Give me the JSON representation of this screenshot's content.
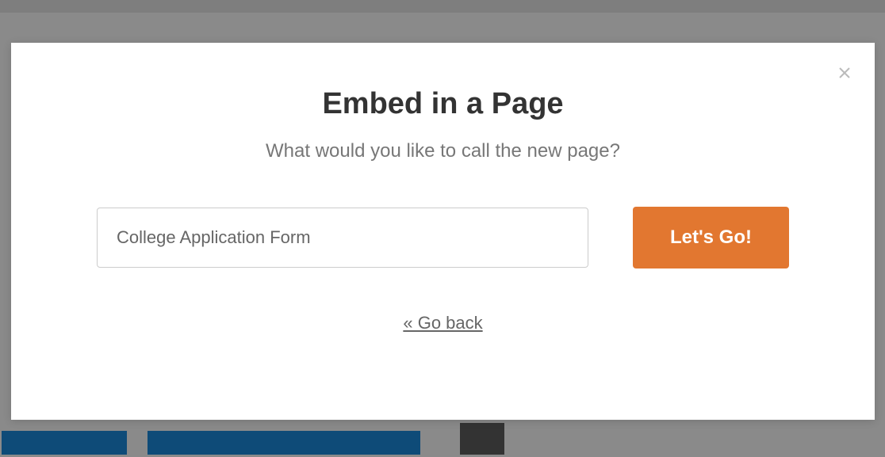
{
  "modal": {
    "title": "Embed in a Page",
    "subtitle": "What would you like to call the new page?",
    "input": {
      "value": "College Application Form",
      "placeholder": ""
    },
    "submit_label": "Let's Go!",
    "go_back_label": "« Go back",
    "close_icon": "close"
  },
  "colors": {
    "accent": "#e27730",
    "title": "#333333",
    "subtitle": "#777777",
    "input_text": "#666666",
    "border": "#cccccc"
  }
}
